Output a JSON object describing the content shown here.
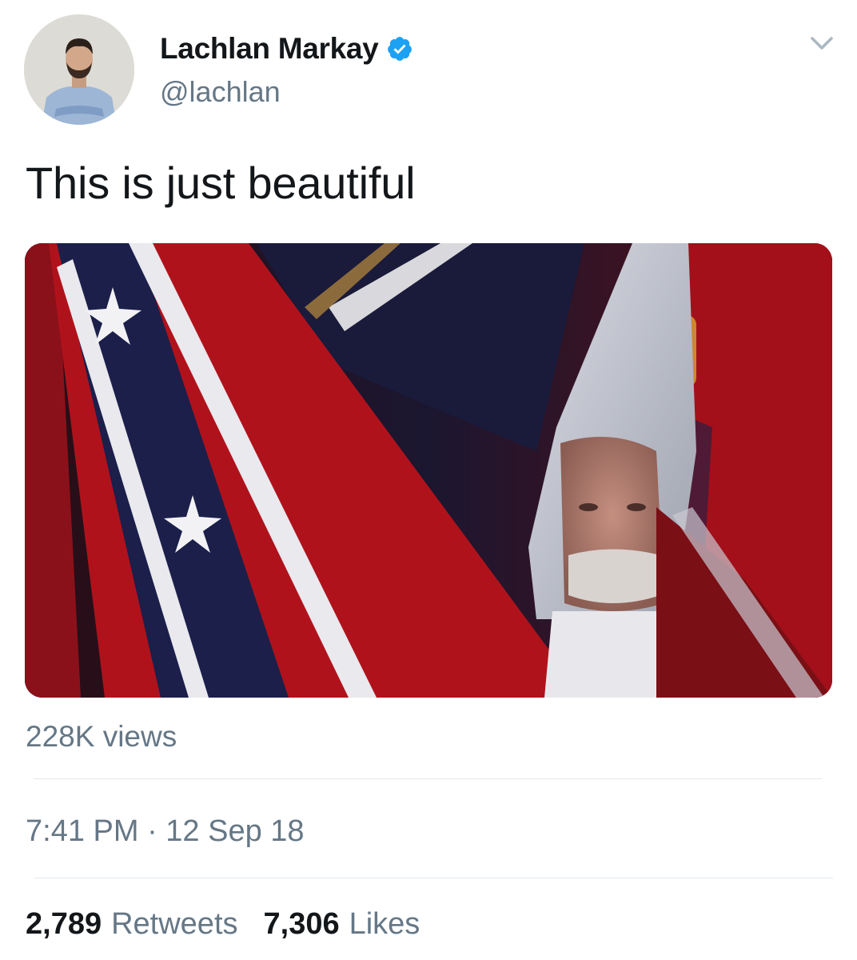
{
  "author": {
    "display_name": "Lachlan Markay",
    "handle": "@lachlan",
    "verified": true,
    "verified_color": "#1da1f2"
  },
  "tweet": {
    "text": "This is just beautiful",
    "views": "228K views",
    "timestamp": "7:41 PM · 12 Sep 18"
  },
  "stats": {
    "retweets_count": "2,789",
    "retweets_label": "Retweets",
    "likes_count": "7,306",
    "likes_label": "Likes"
  },
  "icons": {
    "menu": "chevron-down-icon",
    "verified": "verified-badge-icon"
  },
  "colors": {
    "text_primary": "#14171a",
    "text_secondary": "#657786",
    "divider": "#e1e8ed"
  }
}
